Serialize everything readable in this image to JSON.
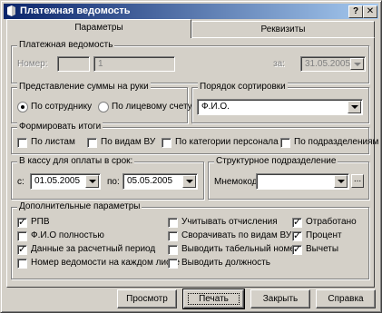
{
  "window": {
    "title": "Платежная ведомость",
    "help_btn": "?",
    "close_btn": "✕"
  },
  "tabs": [
    {
      "label": "Параметры",
      "active": true
    },
    {
      "label": "Реквизиты",
      "active": false
    }
  ],
  "statement": {
    "legend": "Платежная ведомость",
    "number_label": "Номер:",
    "number_prefix": "",
    "number_value": "1",
    "date_label": "за:",
    "date_value": "31.05.2005"
  },
  "amount_view": {
    "legend": "Представление суммы на руки",
    "options": [
      {
        "label": "По сотруднику",
        "checked": true
      },
      {
        "label": "По лицевому счету",
        "checked": false
      }
    ]
  },
  "sort_order": {
    "legend": "Порядок сортировки",
    "value": "Ф.И.О."
  },
  "totals": {
    "legend": "Формировать итоги",
    "options": [
      {
        "label": "По листам",
        "checked": false
      },
      {
        "label": "По видам ВУ",
        "checked": false
      },
      {
        "label": "По категории персонала",
        "checked": false
      },
      {
        "label": "По подразделениям",
        "checked": false
      }
    ]
  },
  "payment_period": {
    "legend": "В кассу для оплаты в срок:",
    "from_label": "с:",
    "from_value": "01.05.2005",
    "to_label": "по:",
    "to_value": "05.05.2005"
  },
  "department": {
    "legend": "Структурное подразделение",
    "mnemo_label": "Мнемокод:",
    "mnemo_value": "",
    "browse_label": "..."
  },
  "extra": {
    "legend": "Дополнительные параметры",
    "col1": [
      {
        "label": "РПВ",
        "checked": true
      },
      {
        "label": "Ф.И.О полностью",
        "checked": false
      },
      {
        "label": "Данные за расчетный период",
        "checked": true
      },
      {
        "label": "Номер ведомости на каждом листе",
        "checked": false
      }
    ],
    "col2": [
      {
        "label": "Учитывать отчисления",
        "checked": false
      },
      {
        "label": "Сворачивать по видам ВУ",
        "checked": false
      },
      {
        "label": "Выводить табельный номер",
        "checked": false
      },
      {
        "label": "Выводить должность",
        "checked": false
      }
    ],
    "col3": [
      {
        "label": "Отработано",
        "checked": true
      },
      {
        "label": "Процент",
        "checked": true
      },
      {
        "label": "Вычеты",
        "checked": true
      }
    ]
  },
  "buttons": {
    "preview": "Просмотр",
    "print": "Печать",
    "close": "Закрыть",
    "help": "Справка"
  }
}
